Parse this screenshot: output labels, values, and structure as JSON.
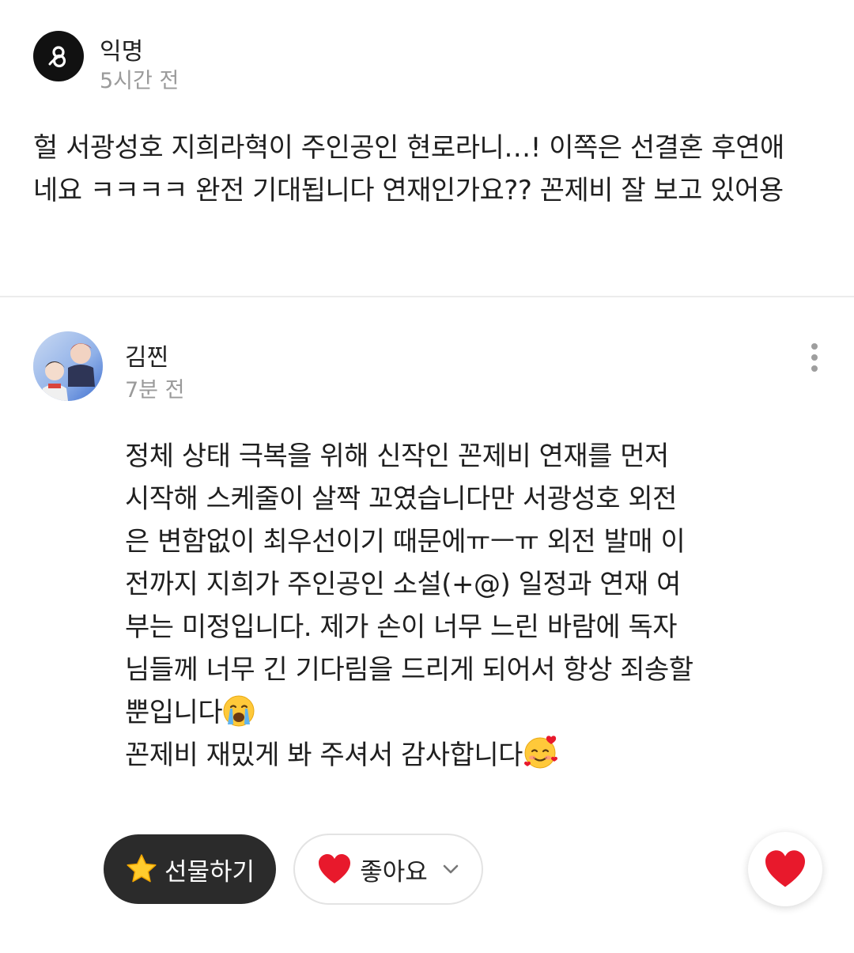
{
  "comment1": {
    "username": "익명",
    "time": "5시간 전",
    "text": "헐 서광성호 지희라혁이 주인공인 현로라니…! 이쪽은 선결혼 후연애\n네요 ㅋㅋㅋㅋ 완전 기대됩니다 연재인가요?? 꼰제비 잘 보고 있어용"
  },
  "comment2": {
    "username": "김찐",
    "time": "7분 전",
    "text_main": "정체 상태 극복을 위해 신작인 꼰제비 연재를 먼저\n시작해 스케줄이 살짝 꼬였습니다만 서광성호 외전\n은 변함없이 최우선이기 때문에ㅠㅡㅠ 외전 발매 이\n전까지 지희가 주인공인 소설(+@) 일정과 연재 여\n부는 미정입니다. 제가 손이 너무 느린 바람에 독자\n님들께 너무 긴 기다림을 드리게 되어서 항상 죄송할\n뿐입니다",
    "text_thanks": "꼰제비 재밌게 봐 주셔서 감사합니다"
  },
  "actions": {
    "gift_label": "선물하기",
    "like_label": "좋아요"
  },
  "icons": {
    "avatar1": "anonymous-logo-icon",
    "gift": "star-icon",
    "like": "heart-icon",
    "like_dropdown": "chevron-down-icon",
    "more": "more-vertical-icon",
    "crying": "crying-face-emoji",
    "smiling_hearts": "smiling-face-with-hearts-emoji"
  },
  "colors": {
    "gift_button_bg": "#2b2b2b",
    "heart": "#e8192c",
    "star": "#ffcc2e",
    "muted_text": "#9a9a9a"
  }
}
